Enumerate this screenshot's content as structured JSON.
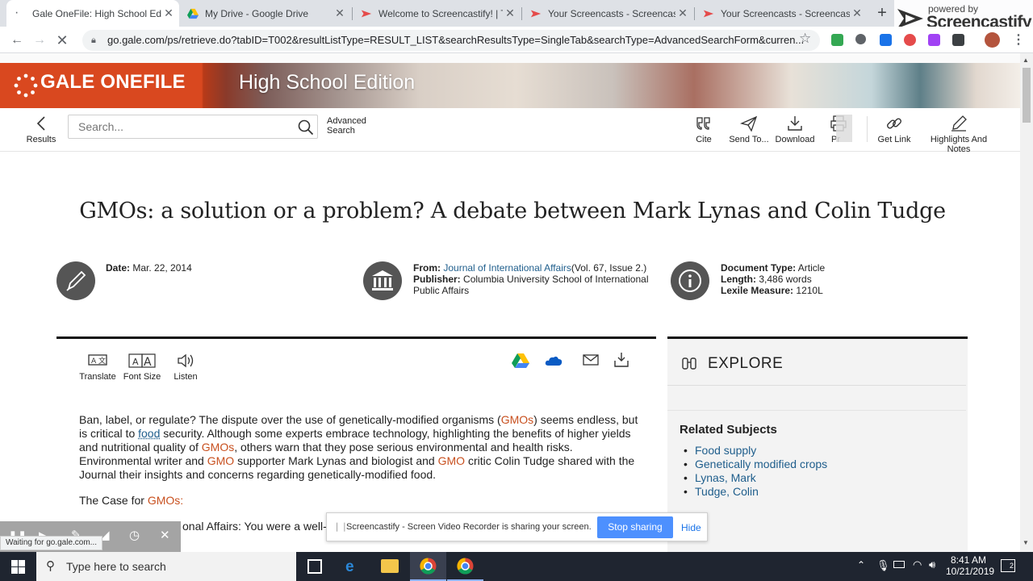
{
  "browser": {
    "tabs": [
      {
        "title": "Gale OneFile: High School Edition",
        "active": true
      },
      {
        "title": "My Drive - Google Drive",
        "active": false
      },
      {
        "title": "Welcome to Screencastify! | Th",
        "active": false
      },
      {
        "title": "Your Screencasts - Screencastif",
        "active": false
      },
      {
        "title": "Your Screencasts - Screencastif",
        "active": false
      }
    ],
    "new_tab": "+",
    "url": "go.gale.com/ps/retrieve.do?tabID=T002&resultListType=RESULT_LIST&searchResultsType=SingleTab&searchType=AdvancedSearchForm&curren...",
    "status": "Waiting for go.gale.com..."
  },
  "overlay": {
    "powered_by": "powered by",
    "brand": "Screencastify"
  },
  "header": {
    "brand": "GALE ONEFILE",
    "edition": "High School Edition"
  },
  "toolbar": {
    "results": "Results",
    "search_placeholder": "Search...",
    "advanced": "Advanced",
    "search": "Search",
    "cite": "Cite",
    "send_to": "Send To...",
    "download": "Download",
    "print": "Pr",
    "get_link": "Get Link",
    "highlights": "Highlights And Notes"
  },
  "article": {
    "title": "GMOs: a solution or a problem? A debate between Mark Lynas and Colin Tudge",
    "date_label": "Date:",
    "date": "Mar. 22, 2014",
    "from_label": "From:",
    "from_source": "Journal of International Affairs",
    "from_detail": "(Vol. 67, Issue 2.)",
    "publisher_label": "Publisher:",
    "publisher": "Columbia University School of International Public Affairs",
    "doctype_label": "Document Type:",
    "doctype": "Article",
    "length_label": "Length:",
    "length": "3,486 words",
    "lexile_label": "Lexile Measure:",
    "lexile": "1210L",
    "tools": {
      "translate": "Translate",
      "font_size": "Font Size",
      "listen": "Listen"
    },
    "para1": {
      "a": "Ban, label, or regulate? The dispute over the use of genetically-modified organisms (",
      "b": "GMOs",
      "c": ") seems endless, but is critical to ",
      "d": "food",
      "e": " security. Although some experts embrace technology, highlighting the benefits of higher yields and nutritional quality of ",
      "f": "GMOs",
      "g": ", others warn that they pose serious environmental and health risks. Environmental writer and ",
      "h": "GMO",
      "i": " supporter Mark Lynas and biologist and ",
      "j": "GMO",
      "k": " critic Colin Tudge shared with the Journal their insights and concerns regarding genetically-modified food."
    },
    "case_heading_a": "The Case for ",
    "case_heading_b": "GMOs:",
    "para2": "onal Affairs: You were a well-known opponent of"
  },
  "explore": {
    "heading": "EXPLORE",
    "related_heading": "Related Subjects",
    "subjects": [
      "Food supply",
      "Genetically modified crops",
      "Lynas, Mark",
      "Tudge, Colin"
    ]
  },
  "share_bar": {
    "message": "Screencastify - Screen Video Recorder is sharing your screen.",
    "stop": "Stop sharing",
    "hide": "Hide"
  },
  "taskbar": {
    "search_placeholder": "Type here to search",
    "time": "8:41 AM",
    "date": "10/21/2019",
    "notifications": "2"
  },
  "colors": {
    "brand_orange": "#d9481f",
    "link": "#1f5e8c",
    "highlight": "#c8501f",
    "share_blue": "#4d90fe"
  }
}
